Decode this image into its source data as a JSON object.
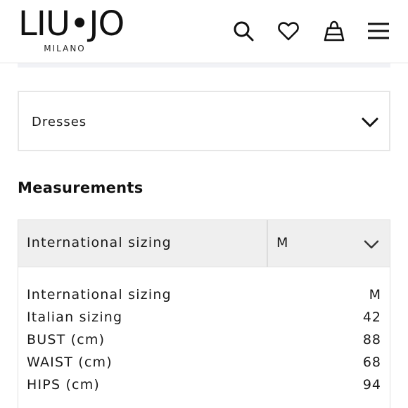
{
  "brand": {
    "name": "LIU•JO",
    "subtitle": "MILANO"
  },
  "header_icons": [
    "search-icon",
    "heart-icon",
    "shopping-bag-icon",
    "hamburger-menu-icon"
  ],
  "category_dropdown": {
    "selected": "Dresses"
  },
  "measurements": {
    "title": "Measurements",
    "selector": {
      "label": "International sizing",
      "selected_size": "M"
    },
    "rows": [
      {
        "label": "International sizing",
        "value": "M"
      },
      {
        "label": "Italian sizing",
        "value": "42"
      },
      {
        "label": "BUST (cm)",
        "value": "88"
      },
      {
        "label": "WAIST (cm)",
        "value": "68"
      },
      {
        "label": "HIPS (cm)",
        "value": "94"
      }
    ]
  },
  "colors": {
    "text": "#1a1a1a",
    "border": "#e6e6e6",
    "selector_bg": "#efefef"
  }
}
